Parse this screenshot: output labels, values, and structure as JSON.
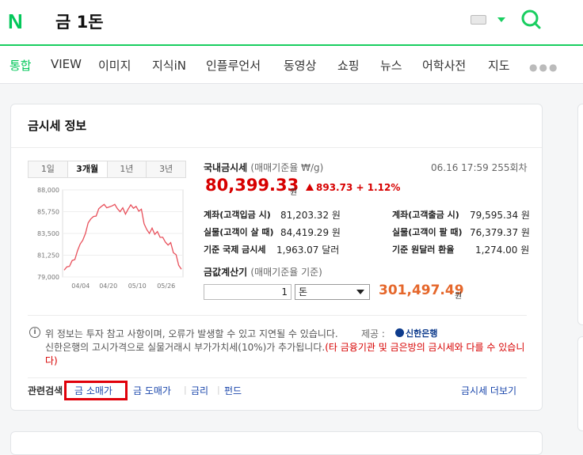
{
  "header": {
    "logo": "N",
    "query": "금 1돈"
  },
  "tabs": [
    "통합",
    "VIEW",
    "이미지",
    "지식iN",
    "인플루언서",
    "동영상",
    "쇼핑",
    "뉴스",
    "어학사전",
    "지도"
  ],
  "card": {
    "title": "금시세 정보",
    "periods": [
      "1일",
      "3개월",
      "1년",
      "3년"
    ],
    "active_period": "3개월",
    "price": {
      "title": "국내금시세",
      "subtitle": "(매매기준율 ₩/g)",
      "time": "06.16 17:59 255회차",
      "value": "80,399.33",
      "unit": "원",
      "change": "893.73 + 1.12%"
    },
    "rows": [
      {
        "label": "계좌(고객입금 시)",
        "value": "81,203.32 원"
      },
      {
        "label": "계좌(고객출금 시)",
        "value": "79,595.34 원"
      },
      {
        "label": "실물(고객이 살 때)",
        "value": "84,419.29 원"
      },
      {
        "label": "실물(고객이 팔 때)",
        "value": "76,379.37 원"
      },
      {
        "label": "기준 국제 금시세",
        "value": "1,963.07 달러"
      },
      {
        "label": "기준 원달러 환율",
        "value": "1,274.00 원"
      }
    ],
    "calc": {
      "title": "금값계산기",
      "subtitle": "(매매기준율 기준)",
      "qty": "1",
      "unit": "돈",
      "result": "301,497.49",
      "result_unit": "원"
    },
    "notice": {
      "line1": "위 정보는 투자 참고 사항이며, 오류가 발생할 수 있고 지연될 수 있습니다.",
      "provider_label": "제공 :",
      "provider": "신한은행",
      "line2": "신한은행의 고시가격으로 실물거래시 부가가치세(10%)가 추가됩니다.",
      "line2_warn": "(타 금융기관 및 금은방의 금시세와 다를 수 있습니다)"
    },
    "related": {
      "label": "관련검색",
      "items": [
        "금 소매가",
        "금 도매가",
        "금리",
        "펀드"
      ],
      "more": "금시세 더보기"
    }
  },
  "chart_data": {
    "type": "line",
    "y_ticks": [
      "88,000",
      "85,750",
      "83,500",
      "81,250",
      "79,000"
    ],
    "x_ticks": [
      "04/04",
      "04/20",
      "05/10",
      "05/26"
    ],
    "ylim": [
      79000,
      88000
    ],
    "values": [
      79700,
      80050,
      80100,
      80700,
      80800,
      81700,
      82400,
      82800,
      83500,
      84600,
      85000,
      85250,
      85300,
      86050,
      86300,
      86500,
      86150,
      86250,
      86350,
      86500,
      86050,
      85750,
      86150,
      85500,
      86000,
      86450,
      86100,
      86300,
      85800,
      86000,
      84500,
      83900,
      83500,
      84050,
      83400,
      83700,
      83100,
      83100,
      82600,
      82300,
      82550,
      81500,
      81300,
      80200,
      79800
    ],
    "line_color": "#e8505b",
    "grid": true
  }
}
